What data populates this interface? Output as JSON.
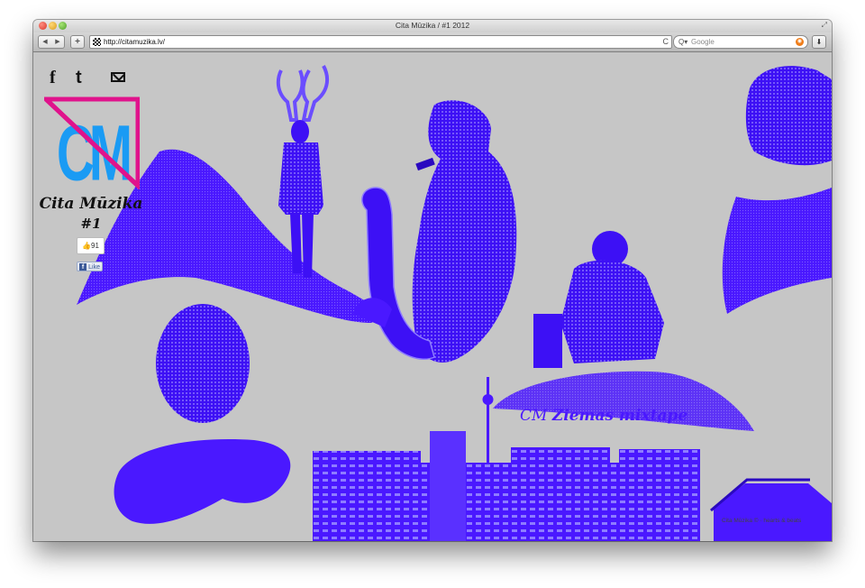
{
  "window": {
    "title": "Cita Mūzika / #1 2012"
  },
  "toolbar": {
    "back": "◀",
    "forward": "▶",
    "add": "+",
    "url": "http://citamuzika.lv/",
    "search_placeholder": "Google",
    "search_icon_glyph": "Q▾",
    "reload_glyph": "C"
  },
  "social": {
    "facebook": "f",
    "twitter": "t"
  },
  "site": {
    "logo_text": "CM",
    "title": "Cita Mūzika",
    "issue": "#1"
  },
  "like": {
    "count": "91",
    "button_label": "Like"
  },
  "mixtape": {
    "prefix": "CM",
    "title": "Ziemas mixtape"
  },
  "footer": {
    "text": "Cita Mūzika © · hearts & beats"
  },
  "colors": {
    "accent_blue": "#4a18ff",
    "logo_cyan": "#1a9bf4",
    "logo_magenta": "#e0138c",
    "page_background": "#c6c6c6"
  }
}
